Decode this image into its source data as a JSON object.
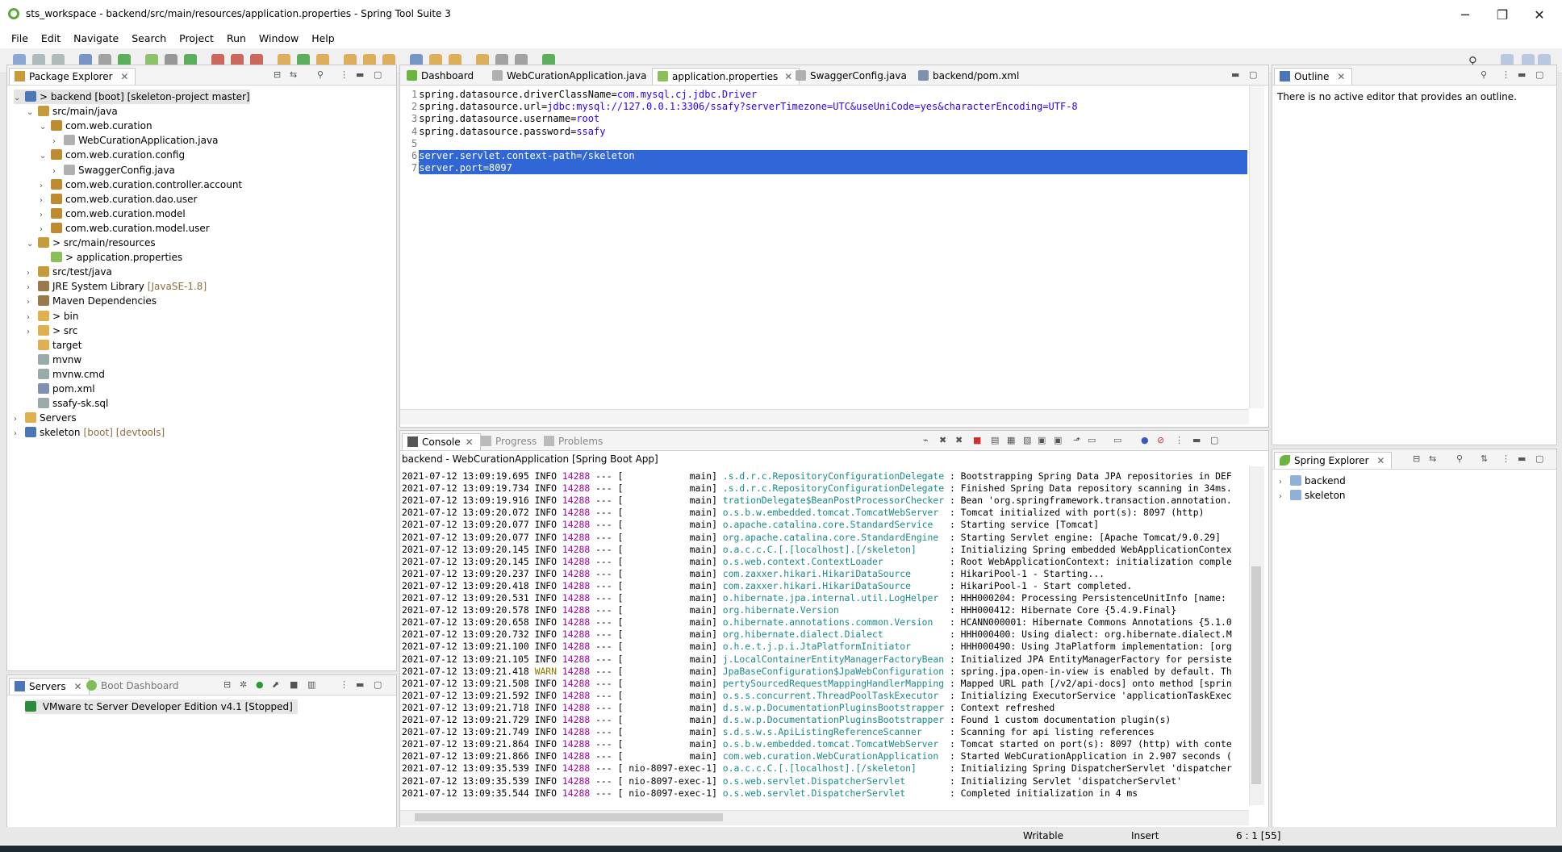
{
  "window": {
    "title": "sts_workspace - backend/src/main/resources/application.properties - Spring Tool Suite 3",
    "minimize": "─",
    "maximize": "❐",
    "close": "✕"
  },
  "menu": [
    "File",
    "Edit",
    "Navigate",
    "Search",
    "Project",
    "Run",
    "Window",
    "Help"
  ],
  "package_explorer": {
    "title": "Package Explorer",
    "items": [
      {
        "label": "> backend [boot] [skeleton-project master]",
        "indent": 0,
        "twisty": "v",
        "icon": "project"
      },
      {
        "label": "src/main/java",
        "indent": 1,
        "twisty": "v",
        "icon": "srcfolder"
      },
      {
        "label": "com.web.curation",
        "indent": 2,
        "twisty": "v",
        "icon": "package"
      },
      {
        "label": "WebCurationApplication.java",
        "indent": 3,
        "twisty": ">",
        "icon": "java"
      },
      {
        "label": "com.web.curation.config",
        "indent": 2,
        "twisty": "v",
        "icon": "package"
      },
      {
        "label": "SwaggerConfig.java",
        "indent": 3,
        "twisty": ">",
        "icon": "java"
      },
      {
        "label": "com.web.curation.controller.account",
        "indent": 2,
        "twisty": ">",
        "icon": "package"
      },
      {
        "label": "com.web.curation.dao.user",
        "indent": 2,
        "twisty": ">",
        "icon": "package"
      },
      {
        "label": "com.web.curation.model",
        "indent": 2,
        "twisty": ">",
        "icon": "package"
      },
      {
        "label": "com.web.curation.model.user",
        "indent": 2,
        "twisty": ">",
        "icon": "package"
      },
      {
        "label": "> src/main/resources",
        "indent": 1,
        "twisty": "v",
        "icon": "srcfolder"
      },
      {
        "label": "> application.properties",
        "indent": 2,
        "twisty": "",
        "icon": "props"
      },
      {
        "label": "src/test/java",
        "indent": 1,
        "twisty": ">",
        "icon": "srcfolder"
      },
      {
        "label": "JRE System Library",
        "suffix": "[JavaSE-1.8]",
        "indent": 1,
        "twisty": ">",
        "icon": "library"
      },
      {
        "label": "Maven Dependencies",
        "indent": 1,
        "twisty": ">",
        "icon": "library"
      },
      {
        "label": "> bin",
        "indent": 1,
        "twisty": ">",
        "icon": "folder"
      },
      {
        "label": "> src",
        "indent": 1,
        "twisty": ">",
        "icon": "folder"
      },
      {
        "label": "target",
        "indent": 1,
        "twisty": "",
        "icon": "folder"
      },
      {
        "label": "mvnw",
        "indent": 1,
        "twisty": "",
        "icon": "file"
      },
      {
        "label": "mvnw.cmd",
        "indent": 1,
        "twisty": "",
        "icon": "file"
      },
      {
        "label": "pom.xml",
        "indent": 1,
        "twisty": "",
        "icon": "xml"
      },
      {
        "label": "ssafy-sk.sql",
        "indent": 1,
        "twisty": "",
        "icon": "file"
      },
      {
        "label": "Servers",
        "indent": 0,
        "twisty": ">",
        "icon": "folder"
      },
      {
        "label": "skeleton",
        "suffix": "[boot] [devtools]",
        "indent": 0,
        "twisty": ">",
        "icon": "project"
      }
    ]
  },
  "servers_view": {
    "tab_servers": "Servers",
    "tab_boot": "Boot Dashboard",
    "server": "VMware tc Server Developer Edition v4.1  [Stopped]"
  },
  "editor": {
    "tabs": [
      "Dashboard",
      "WebCurationApplication.java",
      "application.properties",
      "SwaggerConfig.java",
      "backend/pom.xml"
    ],
    "active_tab": "application.properties",
    "lines": [
      {
        "n": "1",
        "key": "spring.datasource.driverClassName=",
        "val": "com.mysql.cj.jdbc.Driver"
      },
      {
        "n": "2",
        "key": "spring.datasource.url=",
        "val": "jdbc:mysql://127.0.0.1:3306/ssafy?serverTimezone=UTC&useUniCode=yes&characterEncoding=UTF-8"
      },
      {
        "n": "3",
        "key": "spring.datasource.username=",
        "val": "root"
      },
      {
        "n": "4",
        "key": "spring.datasource.password=",
        "val": "ssafy"
      },
      {
        "n": "5",
        "key": "",
        "val": ""
      },
      {
        "n": "6",
        "key": "server.servlet.context-path=/skeleton",
        "val": ""
      },
      {
        "n": "7",
        "key": "server.port=8097",
        "val": ""
      }
    ]
  },
  "outline": {
    "title": "Outline",
    "message": "There is no active editor that provides an outline."
  },
  "spring_explorer": {
    "title": "Spring Explorer",
    "items": [
      "backend",
      "skeleton"
    ]
  },
  "console": {
    "tabs": [
      "Console",
      "Progress",
      "Problems"
    ],
    "header": "backend - WebCurationApplication [Spring Boot App]",
    "lines": [
      {
        "ts": "2021-07-12 13:09:19.695",
        "lvl": "INFO",
        "pid": "14288",
        "sep": "--- [",
        "thr": "           main]",
        "logger": ".s.d.r.c.RepositoryConfigurationDelegate",
        "msg": ": Bootstrapping Spring Data JPA repositories in DEF"
      },
      {
        "ts": "2021-07-12 13:09:19.734",
        "lvl": "INFO",
        "pid": "14288",
        "sep": "--- [",
        "thr": "           main]",
        "logger": ".s.d.r.c.RepositoryConfigurationDelegate",
        "msg": ": Finished Spring Data repository scanning in 34ms."
      },
      {
        "ts": "2021-07-12 13:09:19.916",
        "lvl": "INFO",
        "pid": "14288",
        "sep": "--- [",
        "thr": "           main]",
        "logger": "trationDelegate$BeanPostProcessorChecker",
        "msg": ": Bean 'org.springframework.transaction.annotation."
      },
      {
        "ts": "2021-07-12 13:09:20.072",
        "lvl": "INFO",
        "pid": "14288",
        "sep": "--- [",
        "thr": "           main]",
        "logger": "o.s.b.w.embedded.tomcat.TomcatWebServer ",
        "msg": ": Tomcat initialized with port(s): 8097 (http)"
      },
      {
        "ts": "2021-07-12 13:09:20.077",
        "lvl": "INFO",
        "pid": "14288",
        "sep": "--- [",
        "thr": "           main]",
        "logger": "o.apache.catalina.core.StandardService  ",
        "msg": ": Starting service [Tomcat]"
      },
      {
        "ts": "2021-07-12 13:09:20.077",
        "lvl": "INFO",
        "pid": "14288",
        "sep": "--- [",
        "thr": "           main]",
        "logger": "org.apache.catalina.core.StandardEngine ",
        "msg": ": Starting Servlet engine: [Apache Tomcat/9.0.29]"
      },
      {
        "ts": "2021-07-12 13:09:20.145",
        "lvl": "INFO",
        "pid": "14288",
        "sep": "--- [",
        "thr": "           main]",
        "logger": "o.a.c.c.C.[.[localhost].[/skeleton]     ",
        "msg": ": Initializing Spring embedded WebApplicationContex"
      },
      {
        "ts": "2021-07-12 13:09:20.145",
        "lvl": "INFO",
        "pid": "14288",
        "sep": "--- [",
        "thr": "           main]",
        "logger": "o.s.web.context.ContextLoader           ",
        "msg": ": Root WebApplicationContext: initialization comple"
      },
      {
        "ts": "2021-07-12 13:09:20.237",
        "lvl": "INFO",
        "pid": "14288",
        "sep": "--- [",
        "thr": "           main]",
        "logger": "com.zaxxer.hikari.HikariDataSource      ",
        "msg": ": HikariPool-1 - Starting..."
      },
      {
        "ts": "2021-07-12 13:09:20.418",
        "lvl": "INFO",
        "pid": "14288",
        "sep": "--- [",
        "thr": "           main]",
        "logger": "com.zaxxer.hikari.HikariDataSource      ",
        "msg": ": HikariPool-1 - Start completed."
      },
      {
        "ts": "2021-07-12 13:09:20.531",
        "lvl": "INFO",
        "pid": "14288",
        "sep": "--- [",
        "thr": "           main]",
        "logger": "o.hibernate.jpa.internal.util.LogHelper ",
        "msg": ": HHH000204: Processing PersistenceUnitInfo [name:"
      },
      {
        "ts": "2021-07-12 13:09:20.578",
        "lvl": "INFO",
        "pid": "14288",
        "sep": "--- [",
        "thr": "           main]",
        "logger": "org.hibernate.Version                   ",
        "msg": ": HHH000412: Hibernate Core {5.4.9.Final}"
      },
      {
        "ts": "2021-07-12 13:09:20.658",
        "lvl": "INFO",
        "pid": "14288",
        "sep": "--- [",
        "thr": "           main]",
        "logger": "o.hibernate.annotations.common.Version  ",
        "msg": ": HCANN000001: Hibernate Commons Annotations {5.1.0"
      },
      {
        "ts": "2021-07-12 13:09:20.732",
        "lvl": "INFO",
        "pid": "14288",
        "sep": "--- [",
        "thr": "           main]",
        "logger": "org.hibernate.dialect.Dialect           ",
        "msg": ": HHH000400: Using dialect: org.hibernate.dialect.M"
      },
      {
        "ts": "2021-07-12 13:09:21.100",
        "lvl": "INFO",
        "pid": "14288",
        "sep": "--- [",
        "thr": "           main]",
        "logger": "o.h.e.t.j.p.i.JtaPlatformInitiator      ",
        "msg": ": HHH000490: Using JtaPlatform implementation: [org"
      },
      {
        "ts": "2021-07-12 13:09:21.105",
        "lvl": "INFO",
        "pid": "14288",
        "sep": "--- [",
        "thr": "           main]",
        "logger": "j.LocalContainerEntityManagerFactoryBean",
        "msg": ": Initialized JPA EntityManagerFactory for persiste"
      },
      {
        "ts": "2021-07-12 13:09:21.418",
        "lvl": "WARN",
        "pid": "14288",
        "sep": "--- [",
        "thr": "           main]",
        "logger": "JpaBaseConfiguration$JpaWebConfiguration",
        "msg": ": spring.jpa.open-in-view is enabled by default. Th"
      },
      {
        "ts": "2021-07-12 13:09:21.508",
        "lvl": "INFO",
        "pid": "14288",
        "sep": "--- [",
        "thr": "           main]",
        "logger": "pertySourcedRequestMappingHandlerMapping",
        "msg": ": Mapped URL path [/v2/api-docs] onto method [sprin"
      },
      {
        "ts": "2021-07-12 13:09:21.592",
        "lvl": "INFO",
        "pid": "14288",
        "sep": "--- [",
        "thr": "           main]",
        "logger": "o.s.s.concurrent.ThreadPoolTaskExecutor ",
        "msg": ": Initializing ExecutorService 'applicationTaskExec"
      },
      {
        "ts": "2021-07-12 13:09:21.718",
        "lvl": "INFO",
        "pid": "14288",
        "sep": "--- [",
        "thr": "           main]",
        "logger": "d.s.w.p.DocumentationPluginsBootstrapper",
        "msg": ": Context refreshed"
      },
      {
        "ts": "2021-07-12 13:09:21.729",
        "lvl": "INFO",
        "pid": "14288",
        "sep": "--- [",
        "thr": "           main]",
        "logger": "d.s.w.p.DocumentationPluginsBootstrapper",
        "msg": ": Found 1 custom documentation plugin(s)"
      },
      {
        "ts": "2021-07-12 13:09:21.749",
        "lvl": "INFO",
        "pid": "14288",
        "sep": "--- [",
        "thr": "           main]",
        "logger": "s.d.s.w.s.ApiListingReferenceScanner    ",
        "msg": ": Scanning for api listing references"
      },
      {
        "ts": "2021-07-12 13:09:21.864",
        "lvl": "INFO",
        "pid": "14288",
        "sep": "--- [",
        "thr": "           main]",
        "logger": "o.s.b.w.embedded.tomcat.TomcatWebServer ",
        "msg": ": Tomcat started on port(s): 8097 (http) with conte"
      },
      {
        "ts": "2021-07-12 13:09:21.866",
        "lvl": "INFO",
        "pid": "14288",
        "sep": "--- [",
        "thr": "           main]",
        "logger": "com.web.curation.WebCurationApplication ",
        "msg": ": Started WebCurationApplication in 2.907 seconds ("
      },
      {
        "ts": "2021-07-12 13:09:35.539",
        "lvl": "INFO",
        "pid": "14288",
        "sep": "--- [",
        "thr": "nio-8097-exec-1]",
        "logger": "o.a.c.c.C.[.[localhost].[/skeleton]     ",
        "msg": ": Initializing Spring DispatcherServlet 'dispatcher"
      },
      {
        "ts": "2021-07-12 13:09:35.539",
        "lvl": "INFO",
        "pid": "14288",
        "sep": "--- [",
        "thr": "nio-8097-exec-1]",
        "logger": "o.s.web.servlet.DispatcherServlet       ",
        "msg": ": Initializing Servlet 'dispatcherServlet'"
      },
      {
        "ts": "2021-07-12 13:09:35.544",
        "lvl": "INFO",
        "pid": "14288",
        "sep": "--- [",
        "thr": "nio-8097-exec-1]",
        "logger": "o.s.web.servlet.DispatcherServlet       ",
        "msg": ": Completed initialization in 4 ms"
      }
    ]
  },
  "statusbar": {
    "writable": "Writable",
    "insert": "Insert",
    "position": "6 : 1 [55]"
  },
  "colors": {
    "selection": "#3166d6",
    "value_blue": "#2a00ff",
    "pid_purple": "#a000a0",
    "logger_teal": "#1a8a8a"
  }
}
